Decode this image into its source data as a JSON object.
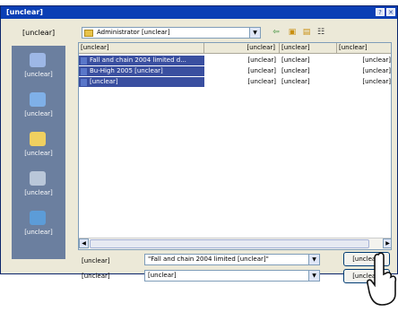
{
  "window": {
    "title": "[unclear]"
  },
  "toolbar": {
    "lookin_label": "[unclear]",
    "lookin_value": "Administrator [unclear]"
  },
  "places": [
    {
      "label": "[unclear]",
      "color": "#9db7e6"
    },
    {
      "label": "[unclear]",
      "color": "#7fb0e8"
    },
    {
      "label": "[unclear]",
      "color": "#f0d060"
    },
    {
      "label": "[unclear]",
      "color": "#b9c7d9"
    },
    {
      "label": "[unclear]",
      "color": "#5c9cd8"
    }
  ],
  "columns": [
    "[unclear]",
    "[unclear]",
    "[unclear]",
    "[unclear]"
  ],
  "files": [
    {
      "name": "Fall and chain 2004 limited d...",
      "size": "[unclear]",
      "type": "[unclear]",
      "date": "[unclear]",
      "selected": true
    },
    {
      "name": "Bu-High 2005 [unclear]",
      "size": "[unclear]",
      "type": "[unclear]",
      "date": "[unclear]",
      "selected": true
    },
    {
      "name": "[unclear]",
      "size": "[unclear]",
      "type": "[unclear]",
      "date": "[unclear]",
      "selected": true
    }
  ],
  "filename": {
    "label": "[unclear]",
    "value": "\"Fall and chain 2004 limited [unclear]\""
  },
  "filetype": {
    "label": "[unclear]",
    "value": "[unclear]"
  },
  "buttons": {
    "open": "[unclear]",
    "cancel": "[unclear]"
  },
  "colors": {
    "title_bar": "#0b3fb5",
    "selection": "#3a4fa0"
  }
}
